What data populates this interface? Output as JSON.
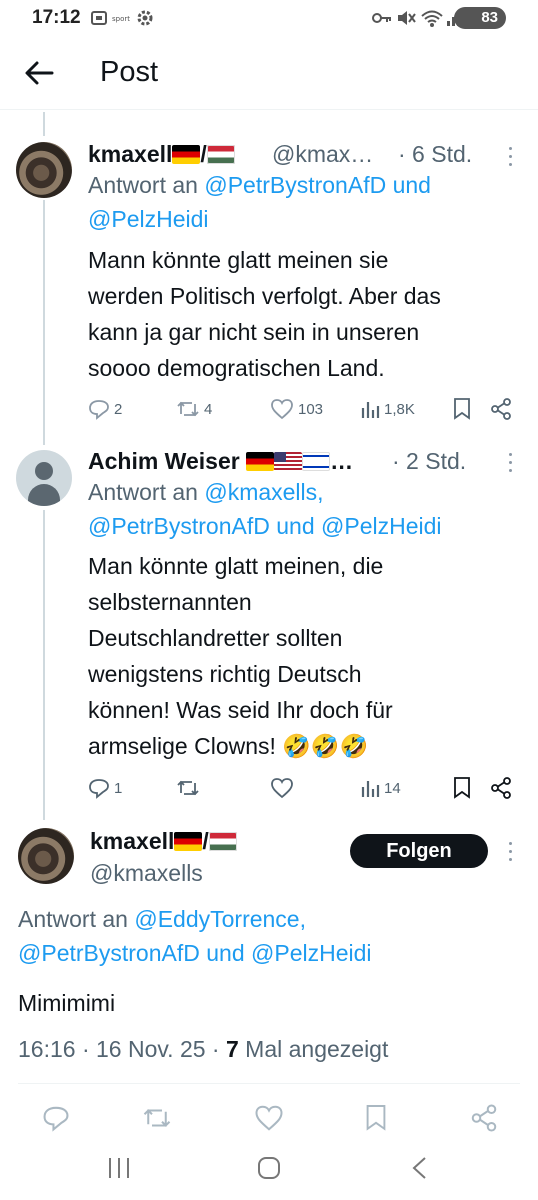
{
  "status_bar": {
    "time": "17:12",
    "battery": "83"
  },
  "header": {
    "title": "Post"
  },
  "replies": [
    {
      "name": "kmaxell",
      "handle": "@kmax…",
      "time": "· 6 Std.",
      "reply_prefix": "Antwort an ",
      "reply_link_1": "@PetrBystronAfD",
      "reply_and": " und",
      "reply_link_2": "@PelzHeidi",
      "text_lines": [
        "Mann könnte glatt meinen sie",
        "werden Politisch verfolgt. Aber das",
        "kann ja gar nicht sein in unseren",
        "soooo demogratischen Land."
      ],
      "stats": {
        "replies": "2",
        "reposts": "4",
        "likes": "103",
        "views": "1,8K"
      }
    },
    {
      "name": "Achim Weiser",
      "handle": "…",
      "time": "· 2 Std.",
      "reply_prefix": "Antwort an ",
      "reply_link_1": "@kmaxells,",
      "reply_link_2": "@PetrBystronAfD",
      "reply_and": " und ",
      "reply_link_3": "@PelzHeidi",
      "text_lines": [
        "Man könnte glatt meinen, die",
        "selbsternannten",
        "Deutschlandretter sollten",
        "wenigstens richtig Deutsch",
        "können! Was seid Ihr doch für",
        "armselige Clowns! 🤣🤣🤣"
      ],
      "stats": {
        "replies": "1",
        "views": "14"
      }
    }
  ],
  "main_post": {
    "name": "kmaxell",
    "handle": "@kmaxells",
    "follow_label": "Folgen",
    "reply_prefix": "Antwort an ",
    "reply_link_1": "@EddyTorrence,",
    "reply_link_2": "@PetrBystronAfD",
    "reply_and": " und ",
    "reply_link_3": "@PelzHeidi",
    "text": "Mimimimi",
    "meta_datetime": "16:16 · 16 Nov. 25 · ",
    "meta_views": "7",
    "meta_views_label": " Mal angezeigt"
  }
}
